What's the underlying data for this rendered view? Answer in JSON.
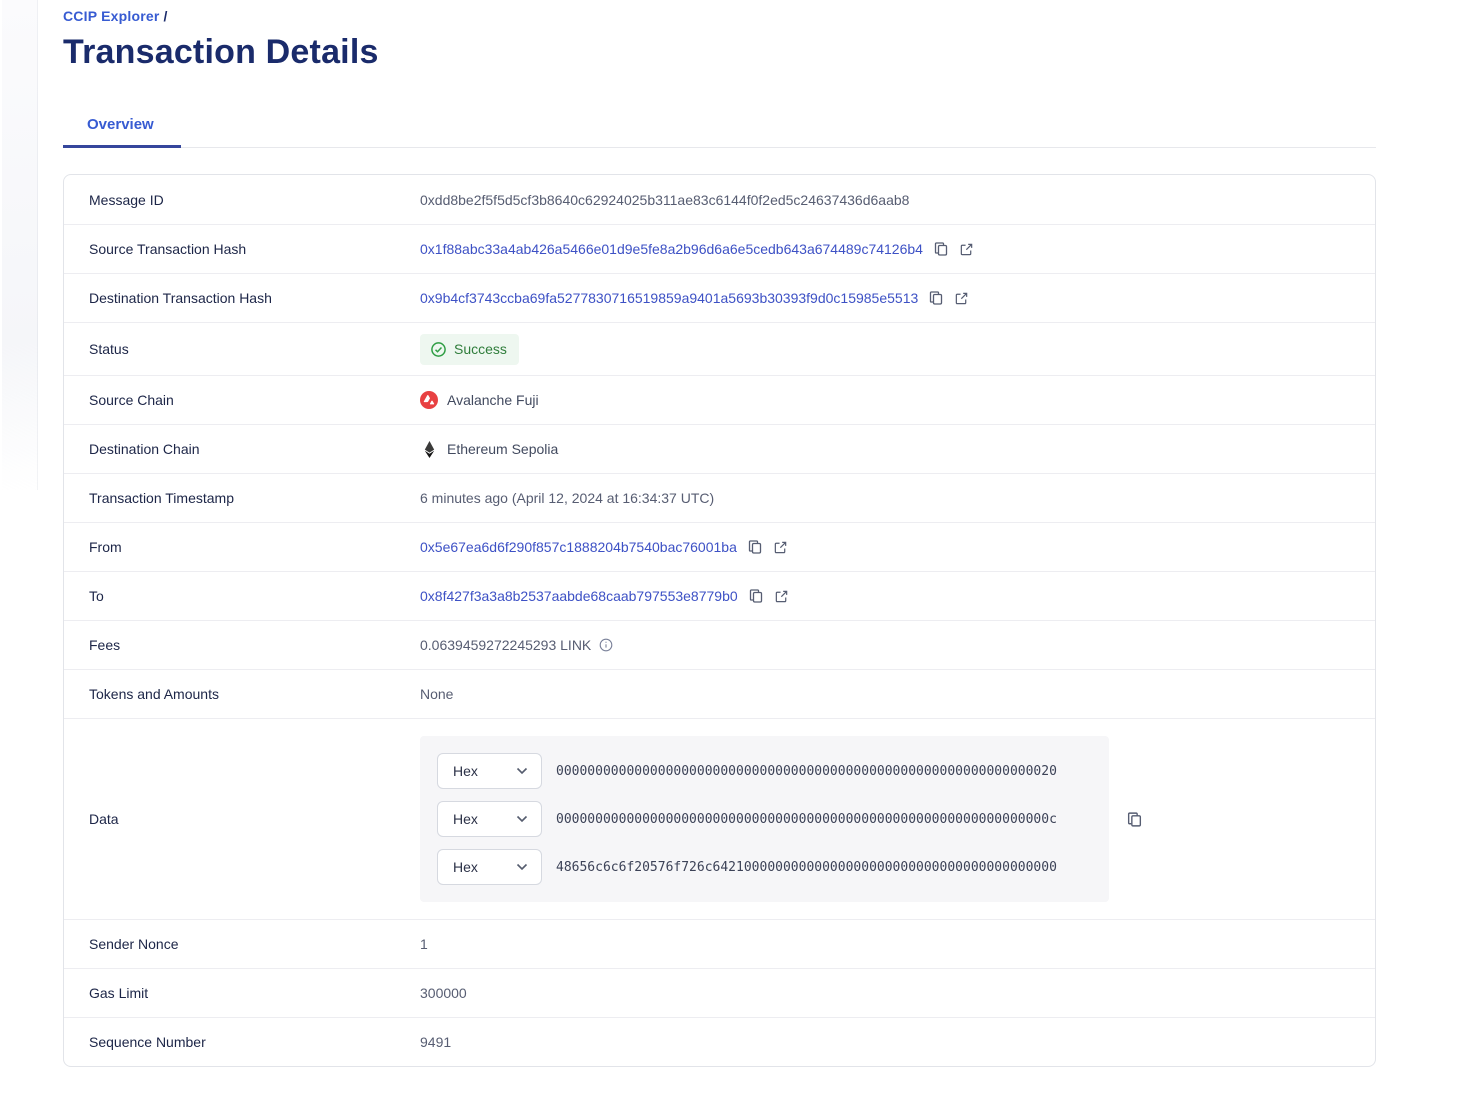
{
  "page": {
    "breadcrumb": "CCIP Explorer",
    "breadcrumb_separator": "/",
    "title": "Transaction Details",
    "tab": "Overview"
  },
  "colors": {
    "link_blue": "#3d51c5",
    "accent_blue": "#375bd2",
    "title_navy": "#1a2b6b",
    "success_text": "#2f7d3b",
    "success_bg": "#eef7f0",
    "avalanche_red": "#e84142"
  },
  "icons": {
    "copy": "copy-icon",
    "external_link": "external-link-icon",
    "check_circle": "check-circle-icon",
    "info": "info-icon",
    "chevron_down": "chevron-down-icon"
  },
  "details": {
    "message_id": {
      "label": "Message ID",
      "value": "0xdd8be2f5f5d5cf3b8640c62924025b311ae83c6144f0f2ed5c24637436d6aab8"
    },
    "source_tx_hash": {
      "label": "Source Transaction Hash",
      "value": "0x1f88abc33a4ab426a5466e01d9e5fe8a2b96d6a6e5cedb643a674489c74126b4"
    },
    "dest_tx_hash": {
      "label": "Destination Transaction Hash",
      "value": "0x9b4cf3743ccba69fa5277830716519859a9401a5693b30393f9d0c15985e5513"
    },
    "status": {
      "label": "Status",
      "value": "Success"
    },
    "source_chain": {
      "label": "Source Chain",
      "value": "Avalanche Fuji"
    },
    "dest_chain": {
      "label": "Destination Chain",
      "value": "Ethereum Sepolia"
    },
    "timestamp": {
      "label": "Transaction Timestamp",
      "value": "6 minutes ago (April 12, 2024 at 16:34:37 UTC)"
    },
    "from": {
      "label": "From",
      "value": "0x5e67ea6d6f290f857c1888204b7540bac76001ba"
    },
    "to": {
      "label": "To",
      "value": "0x8f427f3a3a8b2537aabde68caab797553e8779b0"
    },
    "fees": {
      "label": "Fees",
      "value": "0.0639459272245293 LINK"
    },
    "tokens": {
      "label": "Tokens and Amounts",
      "value": "None"
    },
    "data": {
      "label": "Data",
      "selector_label": "Hex",
      "lines": [
        "0000000000000000000000000000000000000000000000000000000000000020",
        "000000000000000000000000000000000000000000000000000000000000000c",
        "48656c6c6f20576f726c64210000000000000000000000000000000000000000"
      ]
    },
    "sender_nonce": {
      "label": "Sender Nonce",
      "value": "1"
    },
    "gas_limit": {
      "label": "Gas Limit",
      "value": "300000"
    },
    "sequence_number": {
      "label": "Sequence Number",
      "value": "9491"
    }
  }
}
